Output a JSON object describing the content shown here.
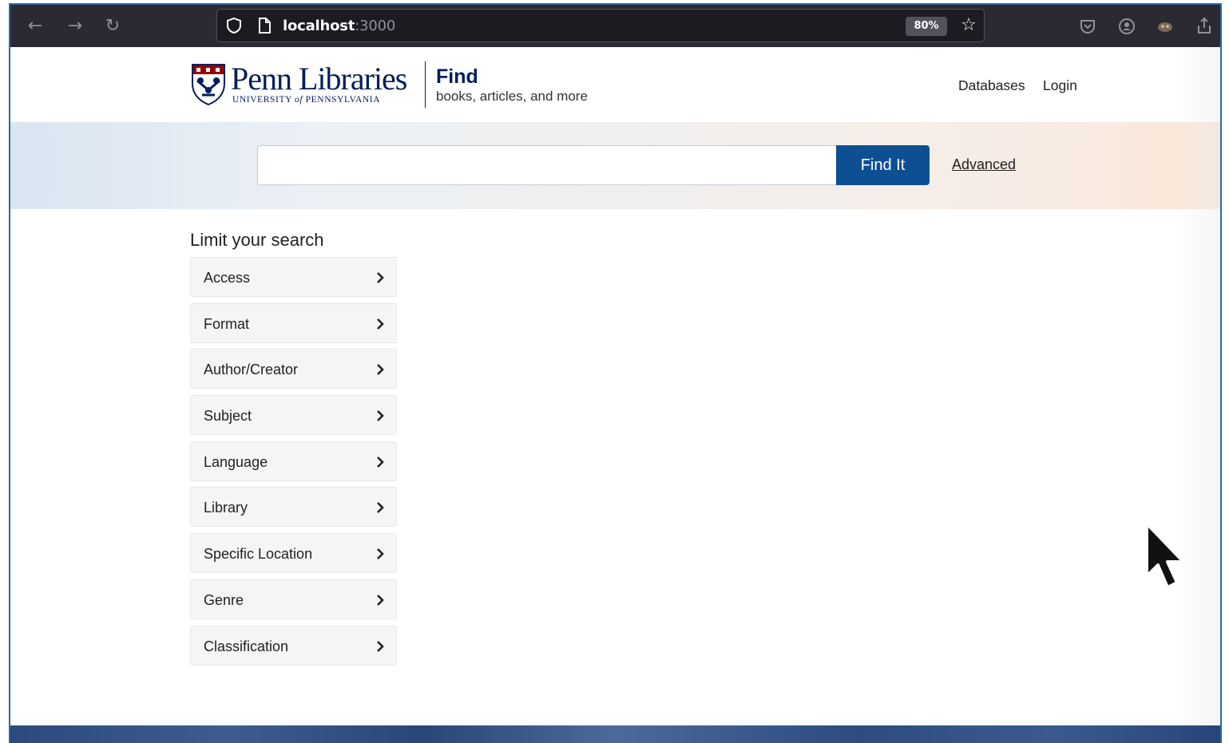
{
  "browser": {
    "url_host": "localhost",
    "url_port": ":3000",
    "zoom": "80%",
    "icons": [
      "back-icon",
      "forward-icon",
      "reload-icon",
      "shield-icon",
      "page-icon",
      "star-icon",
      "pocket-icon",
      "account-icon",
      "extension-icon",
      "share-icon"
    ]
  },
  "header": {
    "logo_word": "Penn Libraries",
    "logo_sub_a": "UNIVERSITY ",
    "logo_sub_of": "of",
    "logo_sub_b": " PENNSYLVANIA",
    "find_title": "Find",
    "find_subtitle": "books, articles, and more",
    "links": {
      "databases": "Databases",
      "login": "Login"
    }
  },
  "search": {
    "query": "",
    "button_label": "Find It",
    "advanced_label": "Advanced"
  },
  "facets": {
    "title": "Limit your search",
    "items": [
      {
        "label": "Access"
      },
      {
        "label": "Format"
      },
      {
        "label": "Author/Creator"
      },
      {
        "label": "Subject"
      },
      {
        "label": "Language"
      },
      {
        "label": "Library"
      },
      {
        "label": "Specific Location"
      },
      {
        "label": "Genre"
      },
      {
        "label": "Classification"
      }
    ]
  },
  "colors": {
    "penn_blue": "#011f5b",
    "button_blue": "#0e4f94",
    "browser_chrome": "#2b2a33"
  }
}
